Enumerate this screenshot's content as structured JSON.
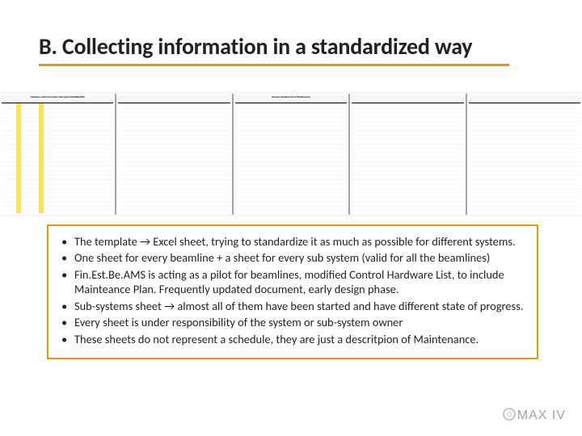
{
  "title": "B. Collecting information in a standardized way",
  "sheets": {
    "s1_header": "Hardware control overview: Sub-system FinEstBeAMS",
    "s2_header": "",
    "s3_header": "Vacuum Hardware List of Maintenance",
    "s4_header": "",
    "s5_header": ""
  },
  "bullets": {
    "b1": "The template → Excel sheet, trying to standardize it as much as possible for different systems.",
    "b2": "One sheet for every beamline + a sheet for every sub system (valid for all the beamlines)",
    "b3": "Fin.Est.Be.AMS is acting as a pilot for beamlines, modified Control Hardware List, to include Mainteance Plan. Frequently updated document, early design phase.",
    "b4": "Sub-systems sheet → almost all of them have been started and have different state of progress.",
    "b5": "Every sheet is under responsibility of the system or sub-system owner",
    "b6": "These sheets do not represent a schedule, they are just a descritpion of Maintenance."
  },
  "logo": {
    "text": "MAX IV"
  }
}
